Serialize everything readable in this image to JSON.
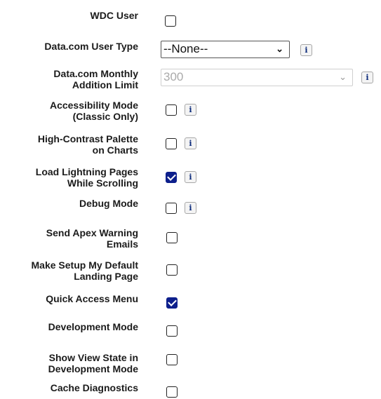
{
  "settings": [
    {
      "label": "WDC User",
      "checked": false
    },
    {
      "label": "Data.com User Type",
      "select_value": "--None--"
    },
    {
      "label": "Data.com Monthly\nAddition Limit",
      "select_value": "300"
    },
    {
      "label": "Accessibility Mode\n(Classic Only)",
      "checked": false
    },
    {
      "label": "High-Contrast Palette\non Charts",
      "checked": false
    },
    {
      "label": "Load Lightning Pages\nWhile Scrolling",
      "checked": true
    },
    {
      "label": "Debug Mode",
      "checked": false
    },
    {
      "label": "Send Apex Warning\nEmails",
      "checked": false
    },
    {
      "label": "Make Setup My Default\nLanding Page",
      "checked": false
    },
    {
      "label": "Quick Access Menu",
      "checked": true
    },
    {
      "label": "Development Mode",
      "checked": false
    },
    {
      "label": "Show View State in\nDevelopment Mode",
      "checked": false
    },
    {
      "label": "Cache Diagnostics",
      "checked": false
    }
  ],
  "icons": {
    "info": "i",
    "chevron": "⌄"
  },
  "colors": {
    "checked": "#0d1f8c",
    "label": "#1b1b1b"
  }
}
